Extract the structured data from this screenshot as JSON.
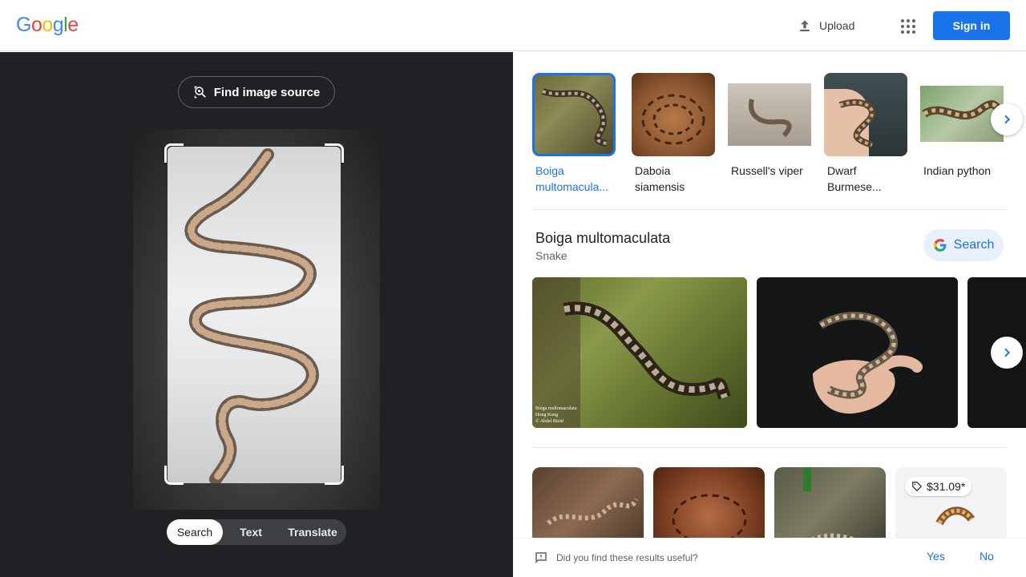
{
  "header": {
    "logo_letters": [
      {
        "ch": "G",
        "color": "#4285F4"
      },
      {
        "ch": "o",
        "color": "#EA4335"
      },
      {
        "ch": "o",
        "color": "#FBBC05"
      },
      {
        "ch": "g",
        "color": "#4285F4"
      },
      {
        "ch": "l",
        "color": "#34A853"
      },
      {
        "ch": "e",
        "color": "#EA4335"
      }
    ],
    "upload_label": "Upload",
    "upload_icon": "upload-icon",
    "apps_icon": "apps-grid-icon",
    "signin_label": "Sign in"
  },
  "left_panel": {
    "find_source_label": "Find image source",
    "find_source_icon": "lens-search-icon",
    "modes": [
      {
        "label": "Search",
        "active": true
      },
      {
        "label": "Text",
        "active": false
      },
      {
        "label": "Translate",
        "active": false
      }
    ]
  },
  "chips": [
    {
      "label": "Boiga multomacula...",
      "selected": true
    },
    {
      "label": "Daboia siamensis",
      "selected": false
    },
    {
      "label": "Russell's viper",
      "selected": false
    },
    {
      "label": "Dwarf Burmese...",
      "selected": false
    },
    {
      "label": "Indian python",
      "selected": false
    }
  ],
  "entity": {
    "title": "Boiga multomaculata",
    "subtitle": "Snake",
    "search_label": "Search"
  },
  "big_images": [
    {
      "caption_lines": [
        "Boiga multomaculata",
        "Hong Kong",
        "© Abdel Bizid"
      ]
    },
    {
      "caption_lines": []
    }
  ],
  "grid_images": [
    {
      "price": ""
    },
    {
      "price": ""
    },
    {
      "price": ""
    },
    {
      "price": "$31.09*"
    }
  ],
  "feedback": {
    "question": "Did you find these results useful?",
    "yes_label": "Yes",
    "no_label": "No"
  },
  "colors": {
    "accent": "#1a73e8",
    "left_bg": "#202124"
  }
}
